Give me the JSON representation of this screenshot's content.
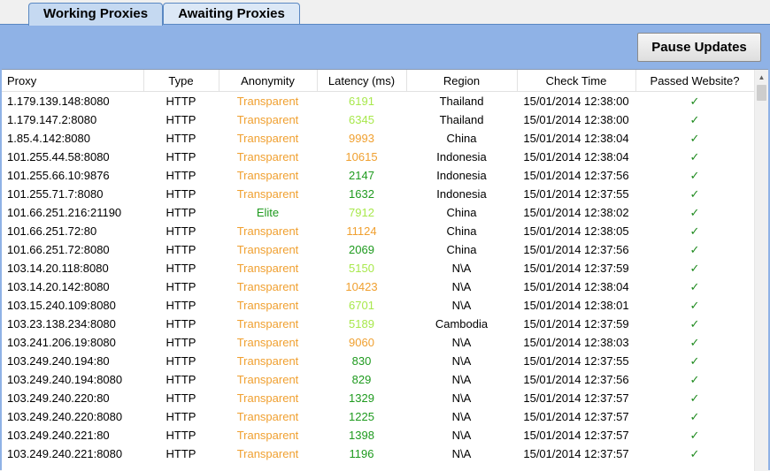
{
  "tabs": [
    {
      "label": "Working Proxies"
    },
    {
      "label": "Awaiting Proxies"
    }
  ],
  "toolbar": {
    "pause_label": "Pause Updates"
  },
  "table": {
    "columns": [
      "Proxy",
      "Type",
      "Anonymity",
      "Latency (ms)",
      "Region",
      "Check Time",
      "Passed Website?"
    ],
    "rows": [
      {
        "proxy": "1.179.139.148:8080",
        "type": "HTTP",
        "anonymity": "Transparent",
        "latency": "6191",
        "region": "Thailand",
        "check_time": "15/01/2014 12:38:00",
        "passed": "✓"
      },
      {
        "proxy": "1.179.147.2:8080",
        "type": "HTTP",
        "anonymity": "Transparent",
        "latency": "6345",
        "region": "Thailand",
        "check_time": "15/01/2014 12:38:00",
        "passed": "✓"
      },
      {
        "proxy": "1.85.4.142:8080",
        "type": "HTTP",
        "anonymity": "Transparent",
        "latency": "9993",
        "region": "China",
        "check_time": "15/01/2014 12:38:04",
        "passed": "✓"
      },
      {
        "proxy": "101.255.44.58:8080",
        "type": "HTTP",
        "anonymity": "Transparent",
        "latency": "10615",
        "region": "Indonesia",
        "check_time": "15/01/2014 12:38:04",
        "passed": "✓"
      },
      {
        "proxy": "101.255.66.10:9876",
        "type": "HTTP",
        "anonymity": "Transparent",
        "latency": "2147",
        "region": "Indonesia",
        "check_time": "15/01/2014 12:37:56",
        "passed": "✓"
      },
      {
        "proxy": "101.255.71.7:8080",
        "type": "HTTP",
        "anonymity": "Transparent",
        "latency": "1632",
        "region": "Indonesia",
        "check_time": "15/01/2014 12:37:55",
        "passed": "✓"
      },
      {
        "proxy": "101.66.251.216:21190",
        "type": "HTTP",
        "anonymity": "Elite",
        "latency": "7912",
        "region": "China",
        "check_time": "15/01/2014 12:38:02",
        "passed": "✓"
      },
      {
        "proxy": "101.66.251.72:80",
        "type": "HTTP",
        "anonymity": "Transparent",
        "latency": "11124",
        "region": "China",
        "check_time": "15/01/2014 12:38:05",
        "passed": "✓"
      },
      {
        "proxy": "101.66.251.72:8080",
        "type": "HTTP",
        "anonymity": "Transparent",
        "latency": "2069",
        "region": "China",
        "check_time": "15/01/2014 12:37:56",
        "passed": "✓"
      },
      {
        "proxy": "103.14.20.118:8080",
        "type": "HTTP",
        "anonymity": "Transparent",
        "latency": "5150",
        "region": "N\\A",
        "check_time": "15/01/2014 12:37:59",
        "passed": "✓"
      },
      {
        "proxy": "103.14.20.142:8080",
        "type": "HTTP",
        "anonymity": "Transparent",
        "latency": "10423",
        "region": "N\\A",
        "check_time": "15/01/2014 12:38:04",
        "passed": "✓"
      },
      {
        "proxy": "103.15.240.109:8080",
        "type": "HTTP",
        "anonymity": "Transparent",
        "latency": "6701",
        "region": "N\\A",
        "check_time": "15/01/2014 12:38:01",
        "passed": "✓"
      },
      {
        "proxy": "103.23.138.234:8080",
        "type": "HTTP",
        "anonymity": "Transparent",
        "latency": "5189",
        "region": "Cambodia",
        "check_time": "15/01/2014 12:37:59",
        "passed": "✓"
      },
      {
        "proxy": "103.241.206.19:8080",
        "type": "HTTP",
        "anonymity": "Transparent",
        "latency": "9060",
        "region": "N\\A",
        "check_time": "15/01/2014 12:38:03",
        "passed": "✓"
      },
      {
        "proxy": "103.249.240.194:80",
        "type": "HTTP",
        "anonymity": "Transparent",
        "latency": "830",
        "region": "N\\A",
        "check_time": "15/01/2014 12:37:55",
        "passed": "✓"
      },
      {
        "proxy": "103.249.240.194:8080",
        "type": "HTTP",
        "anonymity": "Transparent",
        "latency": "829",
        "region": "N\\A",
        "check_time": "15/01/2014 12:37:56",
        "passed": "✓"
      },
      {
        "proxy": "103.249.240.220:80",
        "type": "HTTP",
        "anonymity": "Transparent",
        "latency": "1329",
        "region": "N\\A",
        "check_time": "15/01/2014 12:37:57",
        "passed": "✓"
      },
      {
        "proxy": "103.249.240.220:8080",
        "type": "HTTP",
        "anonymity": "Transparent",
        "latency": "1225",
        "region": "N\\A",
        "check_time": "15/01/2014 12:37:57",
        "passed": "✓"
      },
      {
        "proxy": "103.249.240.221:80",
        "type": "HTTP",
        "anonymity": "Transparent",
        "latency": "1398",
        "region": "N\\A",
        "check_time": "15/01/2014 12:37:57",
        "passed": "✓"
      },
      {
        "proxy": "103.249.240.221:8080",
        "type": "HTTP",
        "anonymity": "Transparent",
        "latency": "1196",
        "region": "N\\A",
        "check_time": "15/01/2014 12:37:57",
        "passed": "✓"
      }
    ]
  },
  "colors": {
    "transparent": "#f0a030",
    "elite": "#1e9a1e",
    "latency_fast": "#1e9a1e",
    "latency_medium": "#a8e84c",
    "latency_slow": "#f0a030",
    "check": "#1e8a1e"
  },
  "icons": {
    "passed": "check-icon",
    "scroll_up": "scroll-up-arrow-icon"
  }
}
